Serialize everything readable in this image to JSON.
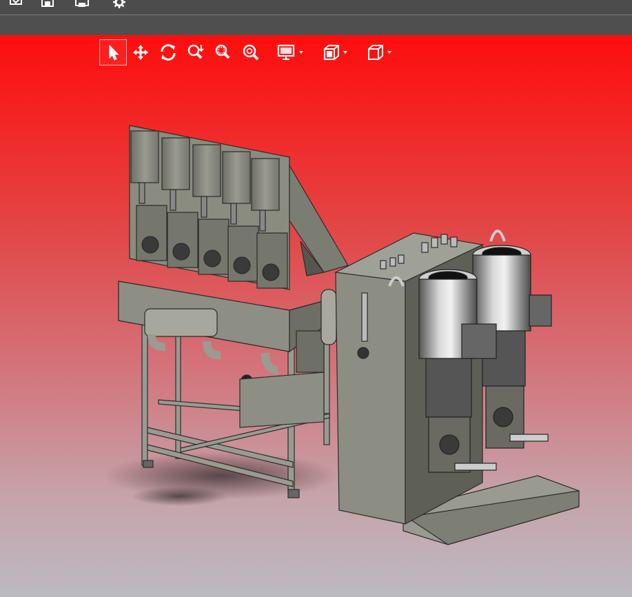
{
  "app": {
    "quick_access": [
      {
        "name": "open-icon",
        "kind": "open"
      },
      {
        "name": "save-icon",
        "kind": "save"
      },
      {
        "name": "print-icon",
        "kind": "print"
      },
      {
        "name": "settings-icon",
        "kind": "settings"
      }
    ]
  },
  "view_toolbar": {
    "tools": [
      {
        "name": "select-icon",
        "active": true
      },
      {
        "name": "pan-icon"
      },
      {
        "name": "rotate-icon"
      },
      {
        "name": "zoom-icon"
      },
      {
        "name": "zoom-box-icon"
      },
      {
        "name": "zoom-fit-icon"
      },
      {
        "name": "display-mode-icon",
        "dropdown": true
      },
      {
        "name": "section-view-icon",
        "dropdown": true
      },
      {
        "name": "standard-views-icon",
        "dropdown": true
      }
    ]
  },
  "colors": {
    "toolbar_bg": "#4c4c4c",
    "viewport_top": "#ff0d0d",
    "viewport_bottom": "#bdb9c1",
    "model_metal": "#8a8a7e"
  }
}
